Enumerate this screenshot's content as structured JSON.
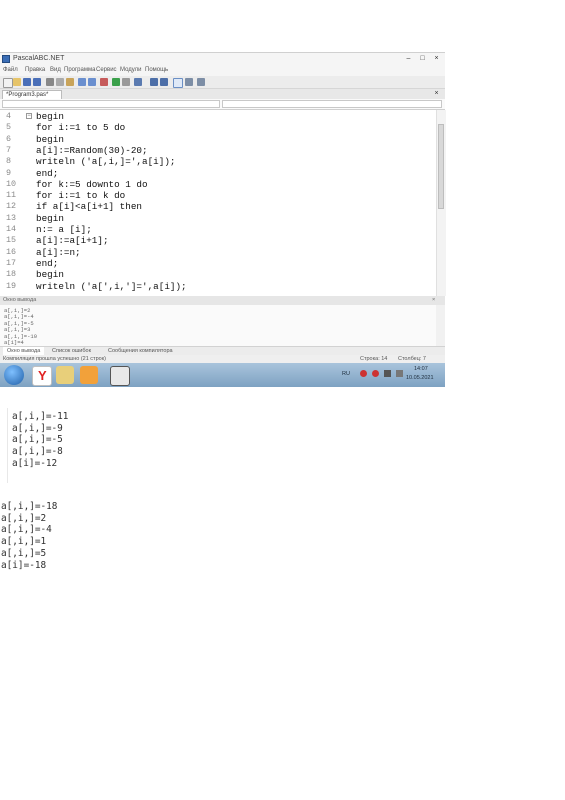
{
  "window": {
    "title": "PascalABC.NET"
  },
  "menu": [
    "Файл",
    "Правка",
    "Вид",
    "Программа",
    "Сервис",
    "Модули",
    "Помощь"
  ],
  "tab": {
    "label": "*Program3.pas*"
  },
  "editor": {
    "lines": [
      {
        "num": "4",
        "text": "begin",
        "fold": true
      },
      {
        "num": "5",
        "text": "for i:=1 to 5 do"
      },
      {
        "num": "6",
        "text": "begin"
      },
      {
        "num": "7",
        "text": "a[i]:=Random(30)-20;"
      },
      {
        "num": "8",
        "text": "writeln ('a[,i,]=',a[i]);"
      },
      {
        "num": "9",
        "text": "end;"
      },
      {
        "num": "10",
        "text": "for k:=5 downto 1 do"
      },
      {
        "num": "11",
        "text": "for i:=1 to k do"
      },
      {
        "num": "12",
        "text": "if a[i]<a[i+1] then"
      },
      {
        "num": "13",
        "text": "begin"
      },
      {
        "num": "14",
        "text": "n:= a [i];"
      },
      {
        "num": "15",
        "text": "a[i]:=a[i+1];"
      },
      {
        "num": "16",
        "text": "a[i]:=n;"
      },
      {
        "num": "17",
        "text": "end;"
      },
      {
        "num": "18",
        "text": "begin"
      },
      {
        "num": "19",
        "text": "writeln ('a[',i,']=',a[i]);"
      }
    ]
  },
  "output_panel": {
    "header": "Окно вывода",
    "lines": [
      "a[,i,]=2",
      "a[,i,]=-4",
      "a[,i,]=-5",
      "a[,i,]=3",
      "a[,i,]=-10",
      "a[i]=4"
    ],
    "tabs": [
      "Окно вывода",
      "Список ошибок",
      "Сообщения компилятора"
    ]
  },
  "statusbar": {
    "message": "Компиляция прошла успешно (21 строк)",
    "row": "Строка: 14",
    "col": "Столбец: 7"
  },
  "tray": {
    "lang": "RU",
    "time": "14:07",
    "date": "10.05.2021"
  },
  "console_block_1": [
    "a[,i,]=-11",
    "a[,i,]=-9",
    "a[,i,]=-5",
    "a[,i,]=-8",
    "a[i]=-12"
  ],
  "console_block_2": [
    "a[,i,]=-18",
    "a[,i,]=2",
    "a[,i,]=-4",
    "a[,i,]=1",
    "a[,i,]=5",
    "a[i]=-18"
  ],
  "colors": {
    "taskbar_top": "#a9c4dc",
    "taskbar_bottom": "#7ea2c2",
    "code_text": "#111111"
  }
}
